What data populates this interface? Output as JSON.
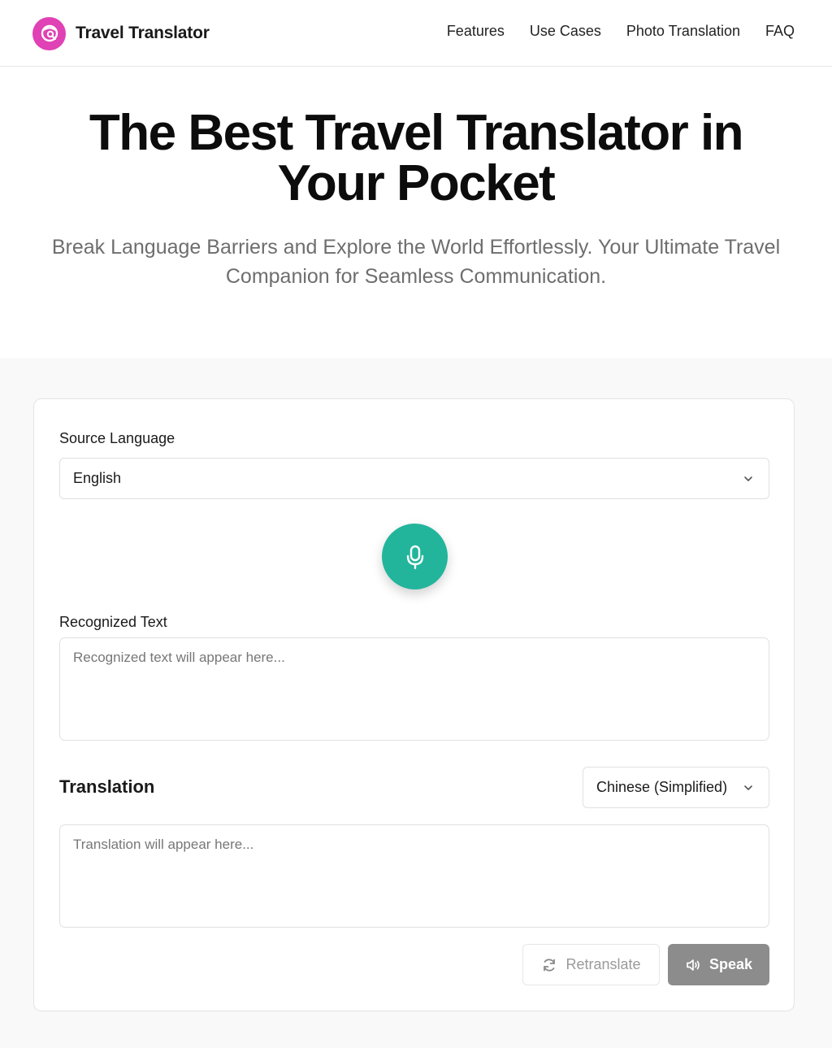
{
  "header": {
    "brand_name": "Travel Translator",
    "logo_icon": "translate-globe-icon",
    "nav": [
      {
        "label": "Features"
      },
      {
        "label": "Use Cases"
      },
      {
        "label": "Photo Translation"
      },
      {
        "label": "FAQ"
      }
    ]
  },
  "hero": {
    "title": "The Best Travel Translator in Your Pocket",
    "subtitle": "Break Language Barriers and Explore the World Effortlessly. Your Ultimate Travel Companion for Seamless Communication."
  },
  "translator": {
    "source_language_label": "Source Language",
    "source_language_value": "English",
    "mic_icon": "microphone-icon",
    "recognized_label": "Recognized Text",
    "recognized_placeholder": "Recognized text will appear here...",
    "translation_label": "Translation",
    "target_language_value": "Chinese (Simplified)",
    "translation_placeholder": "Translation will appear here...",
    "retranslate_label": "Retranslate",
    "speak_label": "Speak"
  },
  "colors": {
    "brand": "#e041b4",
    "mic_button": "#22b59c",
    "speak_button": "#8c8c8c"
  }
}
